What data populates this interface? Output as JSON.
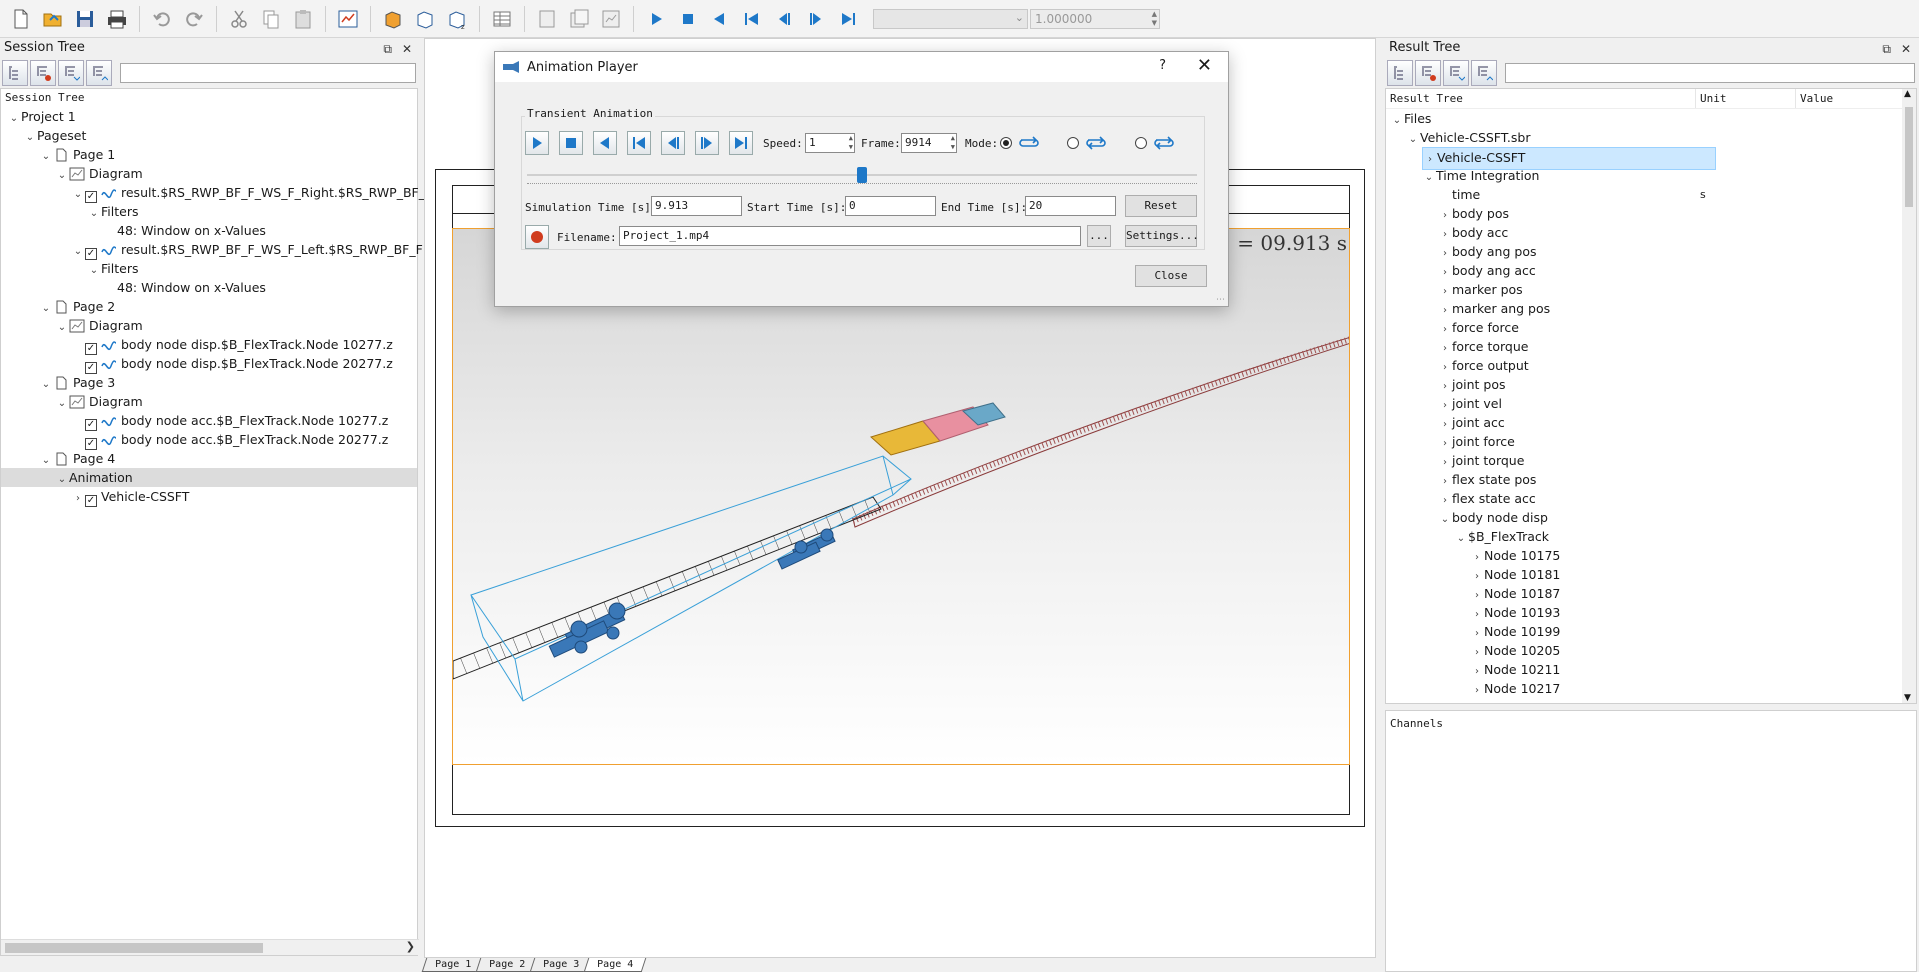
{
  "toolbar": {
    "combo_value": "",
    "spin_value": "1.000000"
  },
  "session_tree": {
    "title": "Session Tree",
    "header": "Session Tree",
    "rows": [
      {
        "indent": 0,
        "caret": "v",
        "text": "Project 1",
        "check": false,
        "icon": ""
      },
      {
        "indent": 1,
        "caret": "v",
        "text": "Pageset",
        "check": false,
        "icon": ""
      },
      {
        "indent": 2,
        "caret": "v",
        "text": "Page 1",
        "check": false,
        "icon": "page"
      },
      {
        "indent": 3,
        "caret": "v",
        "text": "Diagram",
        "check": false,
        "icon": "diagram"
      },
      {
        "indent": 4,
        "caret": "v",
        "text": "result.$RS_RWP_BF_F_WS_F_Right.$RS_RWP_BF_I",
        "check": true,
        "icon": "curve"
      },
      {
        "indent": 5,
        "caret": "v",
        "text": "Filters",
        "check": false,
        "icon": ""
      },
      {
        "indent": 6,
        "caret": "",
        "text": "48: Window on x-Values",
        "check": false,
        "icon": ""
      },
      {
        "indent": 4,
        "caret": "v",
        "text": "result.$RS_RWP_BF_F_WS_F_Left.$RS_RWP_BF_F",
        "check": true,
        "icon": "curve"
      },
      {
        "indent": 5,
        "caret": "v",
        "text": "Filters",
        "check": false,
        "icon": ""
      },
      {
        "indent": 6,
        "caret": "",
        "text": "48: Window on x-Values",
        "check": false,
        "icon": ""
      },
      {
        "indent": 2,
        "caret": "v",
        "text": "Page 2",
        "check": false,
        "icon": "page"
      },
      {
        "indent": 3,
        "caret": "v",
        "text": "Diagram",
        "check": false,
        "icon": "diagram"
      },
      {
        "indent": 4,
        "caret": "",
        "text": "body node disp.$B_FlexTrack.Node 10277.z",
        "check": true,
        "icon": "curve"
      },
      {
        "indent": 4,
        "caret": "",
        "text": "body node disp.$B_FlexTrack.Node 20277.z",
        "check": true,
        "icon": "curve"
      },
      {
        "indent": 2,
        "caret": "v",
        "text": "Page 3",
        "check": false,
        "icon": "page"
      },
      {
        "indent": 3,
        "caret": "v",
        "text": "Diagram",
        "check": false,
        "icon": "diagram"
      },
      {
        "indent": 4,
        "caret": "",
        "text": "body node acc.$B_FlexTrack.Node 10277.z",
        "check": true,
        "icon": "curve"
      },
      {
        "indent": 4,
        "caret": "",
        "text": "body node acc.$B_FlexTrack.Node 20277.z",
        "check": true,
        "icon": "curve"
      },
      {
        "indent": 2,
        "caret": "v",
        "text": "Page 4",
        "check": false,
        "icon": "page"
      },
      {
        "indent": 3,
        "caret": "v",
        "text": "Animation",
        "check": false,
        "icon": "",
        "selected": true
      },
      {
        "indent": 4,
        "caret": ">",
        "text": "Vehicle-CSSFT",
        "check": true,
        "icon": ""
      }
    ]
  },
  "center": {
    "time_label": "= 09.913 s",
    "tabs": [
      "Page 1",
      "Page 2",
      "Page 3",
      "Page 4"
    ],
    "active_tab": "Page 4"
  },
  "dialog": {
    "title": "Animation Player",
    "help": "?",
    "group_label": "Transient Animation",
    "speed_label": "Speed:",
    "speed_value": "1",
    "frame_label": "Frame:",
    "frame_value": "9914",
    "mode_label": "Mode:",
    "slider_fraction": 0.5,
    "sim_time_label": "Simulation Time [s]:",
    "sim_time_value": "9.913",
    "start_time_label": "Start Time [s]:",
    "start_time_value": "0",
    "end_time_label": "End Time [s]:",
    "end_time_value": "20",
    "reset_label": "Reset",
    "filename_label": "Filename:",
    "filename_value": "Project_1.mp4",
    "browse_label": "...",
    "settings_label": "Settings...",
    "close_label": "Close"
  },
  "result_tree": {
    "title": "Result Tree",
    "col_tree": "Result Tree",
    "col_unit": "Unit",
    "col_value": "Value",
    "rows": [
      {
        "indent": 0,
        "caret": "v",
        "text": "Files",
        "unit": ""
      },
      {
        "indent": 1,
        "caret": "v",
        "text": "Vehicle-CSSFT.sbr",
        "unit": ""
      },
      {
        "indent": 2,
        "caret": ">",
        "text": "Vehicle-CSSFT",
        "unit": "",
        "selected": true
      },
      {
        "indent": 2,
        "caret": "v",
        "text": "Time Integration",
        "unit": ""
      },
      {
        "indent": 3,
        "caret": "",
        "text": "time",
        "unit": "s"
      },
      {
        "indent": 3,
        "caret": ">",
        "text": "body pos",
        "unit": ""
      },
      {
        "indent": 3,
        "caret": ">",
        "text": "body acc",
        "unit": ""
      },
      {
        "indent": 3,
        "caret": ">",
        "text": "body ang pos",
        "unit": ""
      },
      {
        "indent": 3,
        "caret": ">",
        "text": "body ang acc",
        "unit": ""
      },
      {
        "indent": 3,
        "caret": ">",
        "text": "marker pos",
        "unit": ""
      },
      {
        "indent": 3,
        "caret": ">",
        "text": "marker ang pos",
        "unit": ""
      },
      {
        "indent": 3,
        "caret": ">",
        "text": "force force",
        "unit": ""
      },
      {
        "indent": 3,
        "caret": ">",
        "text": "force torque",
        "unit": ""
      },
      {
        "indent": 3,
        "caret": ">",
        "text": "force output",
        "unit": ""
      },
      {
        "indent": 3,
        "caret": ">",
        "text": "joint pos",
        "unit": ""
      },
      {
        "indent": 3,
        "caret": ">",
        "text": "joint vel",
        "unit": ""
      },
      {
        "indent": 3,
        "caret": ">",
        "text": "joint acc",
        "unit": ""
      },
      {
        "indent": 3,
        "caret": ">",
        "text": "joint force",
        "unit": ""
      },
      {
        "indent": 3,
        "caret": ">",
        "text": "joint torque",
        "unit": ""
      },
      {
        "indent": 3,
        "caret": ">",
        "text": "flex state pos",
        "unit": ""
      },
      {
        "indent": 3,
        "caret": ">",
        "text": "flex state acc",
        "unit": ""
      },
      {
        "indent": 3,
        "caret": "v",
        "text": "body node disp",
        "unit": ""
      },
      {
        "indent": 4,
        "caret": "v",
        "text": "$B_FlexTrack",
        "unit": ""
      },
      {
        "indent": 5,
        "caret": ">",
        "text": "Node 10175",
        "unit": ""
      },
      {
        "indent": 5,
        "caret": ">",
        "text": "Node 10181",
        "unit": ""
      },
      {
        "indent": 5,
        "caret": ">",
        "text": "Node 10187",
        "unit": ""
      },
      {
        "indent": 5,
        "caret": ">",
        "text": "Node 10193",
        "unit": ""
      },
      {
        "indent": 5,
        "caret": ">",
        "text": "Node 10199",
        "unit": ""
      },
      {
        "indent": 5,
        "caret": ">",
        "text": "Node 10205",
        "unit": ""
      },
      {
        "indent": 5,
        "caret": ">",
        "text": "Node 10211",
        "unit": ""
      },
      {
        "indent": 5,
        "caret": ">",
        "text": "Node 10217",
        "unit": ""
      }
    ],
    "channels_label": "Channels"
  },
  "colors": {
    "accent": "#1e78c8",
    "record": "#d03c1e",
    "view_border": "#f0a030",
    "selection": "#cce8ff"
  }
}
